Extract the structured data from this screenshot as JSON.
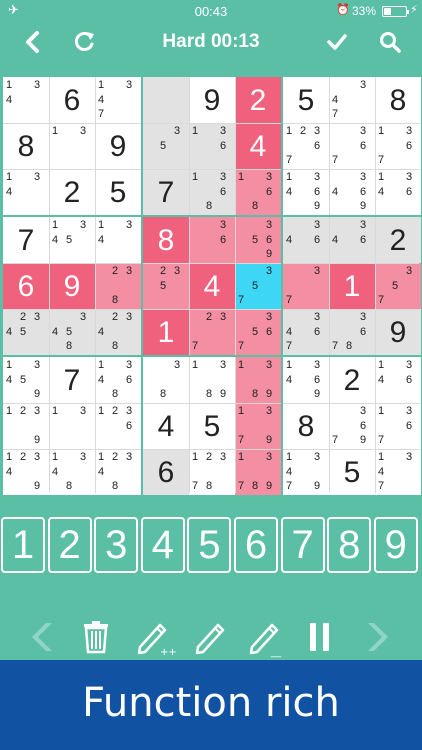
{
  "status_bar": {
    "time": "00:43",
    "battery_text": "33%",
    "battery_level": 0.33,
    "icons": [
      "airplane-icon",
      "alarm-icon",
      "battery-icon",
      "charging-icon"
    ]
  },
  "header": {
    "title": "Hard 00:13",
    "icons": [
      "back-icon",
      "refresh-icon",
      "check-icon",
      "search-icon"
    ]
  },
  "colors": {
    "background": "#5bbfa6",
    "highlight_red": "#f0617d",
    "highlight_red_light": "#f48fa3",
    "selected_cyan": "#3dd6f5",
    "given_gray": "#e2e2e2",
    "banner": "#1152a2"
  },
  "board": {
    "values": [
      [
        "",
        "6",
        "",
        "",
        "9",
        "2",
        "5",
        "",
        "8"
      ],
      [
        "8",
        "",
        "9",
        "",
        "",
        "4",
        "",
        "",
        ""
      ],
      [
        "",
        "2",
        "5",
        "7",
        "",
        "",
        "",
        "",
        ""
      ],
      [
        "7",
        "",
        "",
        "8",
        "",
        "",
        "",
        "",
        "2"
      ],
      [
        "6",
        "9",
        "",
        "",
        "4",
        "",
        "",
        "1",
        ""
      ],
      [
        "",
        "",
        "",
        "1",
        "",
        "",
        "",
        "",
        "9"
      ],
      [
        "",
        "7",
        "",
        "",
        "",
        "",
        "",
        "2",
        ""
      ],
      [
        "",
        "",
        "",
        "4",
        "5",
        "",
        "8",
        "",
        ""
      ],
      [
        "",
        "",
        "",
        "6",
        "",
        "",
        "",
        "5",
        ""
      ]
    ],
    "notes": [
      [
        [
          1,
          3,
          4
        ],
        [],
        [
          1,
          3,
          4,
          7
        ],
        [],
        [],
        [],
        [],
        [
          3,
          4,
          7
        ],
        []
      ],
      [
        [],
        [
          1,
          3
        ],
        [],
        [
          3,
          5
        ],
        [
          1,
          3,
          6
        ],
        [],
        [
          1,
          2,
          3,
          6,
          7
        ],
        [
          3,
          6,
          7
        ],
        [
          1,
          3,
          6,
          7
        ]
      ],
      [
        [
          1,
          3,
          4
        ],
        [],
        [],
        [],
        [
          1,
          3,
          6,
          8
        ],
        [
          1,
          3,
          6,
          8
        ],
        [
          1,
          3,
          4,
          6,
          9
        ],
        [
          3,
          4,
          6,
          9
        ],
        [
          1,
          3,
          4,
          6
        ]
      ],
      [
        [],
        [
          1,
          3,
          4,
          5
        ],
        [
          1,
          3,
          4
        ],
        [],
        [
          3,
          6
        ],
        [
          3,
          5,
          6,
          9
        ],
        [
          3,
          4,
          6
        ],
        [
          3,
          4,
          6
        ],
        []
      ],
      [
        [],
        [],
        [
          2,
          3,
          8
        ],
        [
          2,
          3,
          5
        ],
        [],
        [
          3,
          5,
          7
        ],
        [
          3,
          7
        ],
        [],
        [
          3,
          5,
          7
        ]
      ],
      [
        [
          2,
          3,
          4,
          5
        ],
        [
          3,
          4,
          5,
          8
        ],
        [
          2,
          3,
          4,
          8
        ],
        [],
        [
          2,
          3,
          7
        ],
        [
          3,
          5,
          6,
          7
        ],
        [
          3,
          4,
          6,
          7
        ],
        [
          3,
          6,
          7,
          8
        ],
        []
      ],
      [
        [
          1,
          3,
          4,
          5,
          9
        ],
        [],
        [
          1,
          3,
          4,
          6,
          8
        ],
        [
          3,
          8
        ],
        [
          1,
          3,
          9,
          8
        ],
        [
          1,
          3,
          8,
          9
        ],
        [
          1,
          3,
          4,
          6,
          9
        ],
        [],
        [
          1,
          3,
          4,
          6
        ]
      ],
      [
        [
          1,
          2,
          3,
          9
        ],
        [
          1,
          3
        ],
        [
          1,
          2,
          3,
          6
        ],
        [],
        [],
        [
          1,
          3,
          7,
          9
        ],
        [],
        [
          3,
          6,
          9,
          7
        ],
        [
          1,
          3,
          6,
          7
        ]
      ],
      [
        [
          1,
          2,
          3,
          4,
          9
        ],
        [
          1,
          3,
          4,
          8
        ],
        [
          1,
          2,
          3,
          4,
          8
        ],
        [],
        [
          1,
          2,
          3,
          7,
          8
        ],
        [
          1,
          3,
          7,
          8,
          9
        ],
        [
          1,
          3,
          4,
          7,
          9
        ],
        [],
        [
          1,
          3,
          4,
          7
        ]
      ]
    ],
    "highlight": [
      [
        "w",
        "w",
        "w",
        "g",
        "w",
        "r",
        "w",
        "w",
        "w"
      ],
      [
        "w",
        "w",
        "w",
        "g",
        "g",
        "r",
        "w",
        "w",
        "w"
      ],
      [
        "w",
        "w",
        "w",
        "g",
        "g",
        "l",
        "w",
        "w",
        "w"
      ],
      [
        "w",
        "w",
        "w",
        "r",
        "l",
        "l",
        "g",
        "g",
        "g"
      ],
      [
        "r",
        "r",
        "l",
        "l",
        "r",
        "c",
        "l",
        "r",
        "l"
      ],
      [
        "g",
        "g",
        "g",
        "r",
        "l",
        "l",
        "g",
        "g",
        "g"
      ],
      [
        "w",
        "w",
        "w",
        "w",
        "w",
        "l",
        "w",
        "w",
        "w"
      ],
      [
        "w",
        "w",
        "w",
        "w",
        "w",
        "l",
        "w",
        "w",
        "w"
      ],
      [
        "w",
        "w",
        "w",
        "g",
        "w",
        "l",
        "w",
        "w",
        "w"
      ]
    ]
  },
  "numpad": [
    "1",
    "2",
    "3",
    "4",
    "5",
    "6",
    "7",
    "8",
    "9"
  ],
  "actions": [
    "back-arrow-icon",
    "trash-icon",
    "pencil-plus-icon",
    "pencil-icon",
    "pencil-minus-icon",
    "pause-icon",
    "forward-arrow-icon"
  ],
  "banner": {
    "text": "Function rich"
  }
}
